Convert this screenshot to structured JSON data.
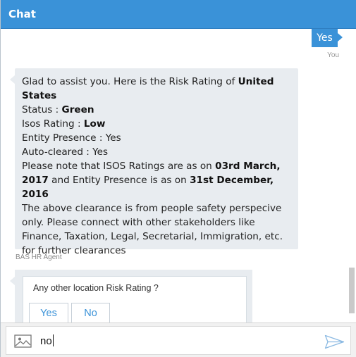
{
  "header": {
    "title": "Chat"
  },
  "user_message": {
    "text": "Yes",
    "sender": "You"
  },
  "bot_message": {
    "intro": "Glad to assist you. Here is the Risk Rating of ",
    "country": "United States",
    "status_label": "Status : ",
    "status_value": "Green",
    "isos_label": "Isos Rating : ",
    "isos_value": "Low",
    "entity_presence": "Entity Presence : Yes",
    "auto_cleared": "Auto-cleared : Yes",
    "note_prefix": "Please note that ISOS Ratings are as on ",
    "isos_date": "03rd March, 2017",
    "note_mid": " and Entity Presence is as on ",
    "entity_date": "31st December, 2016",
    "clearance_note": "The above clearance is from people safety perspecive only. Please connect with other stakeholders like Finance, Taxation, Legal, Secretarial, Immigration, etc. for further clearances",
    "sender": "BAS HR Agent"
  },
  "prompt_card": {
    "question": "Any other location Risk Rating ?",
    "yes_label": "Yes",
    "no_label": "No"
  },
  "composer": {
    "input_value": "no"
  },
  "icons": {
    "attach": "image-icon",
    "send": "send-icon"
  },
  "colors": {
    "accent": "#3a92d8",
    "bubble": "#e8ecf0"
  }
}
